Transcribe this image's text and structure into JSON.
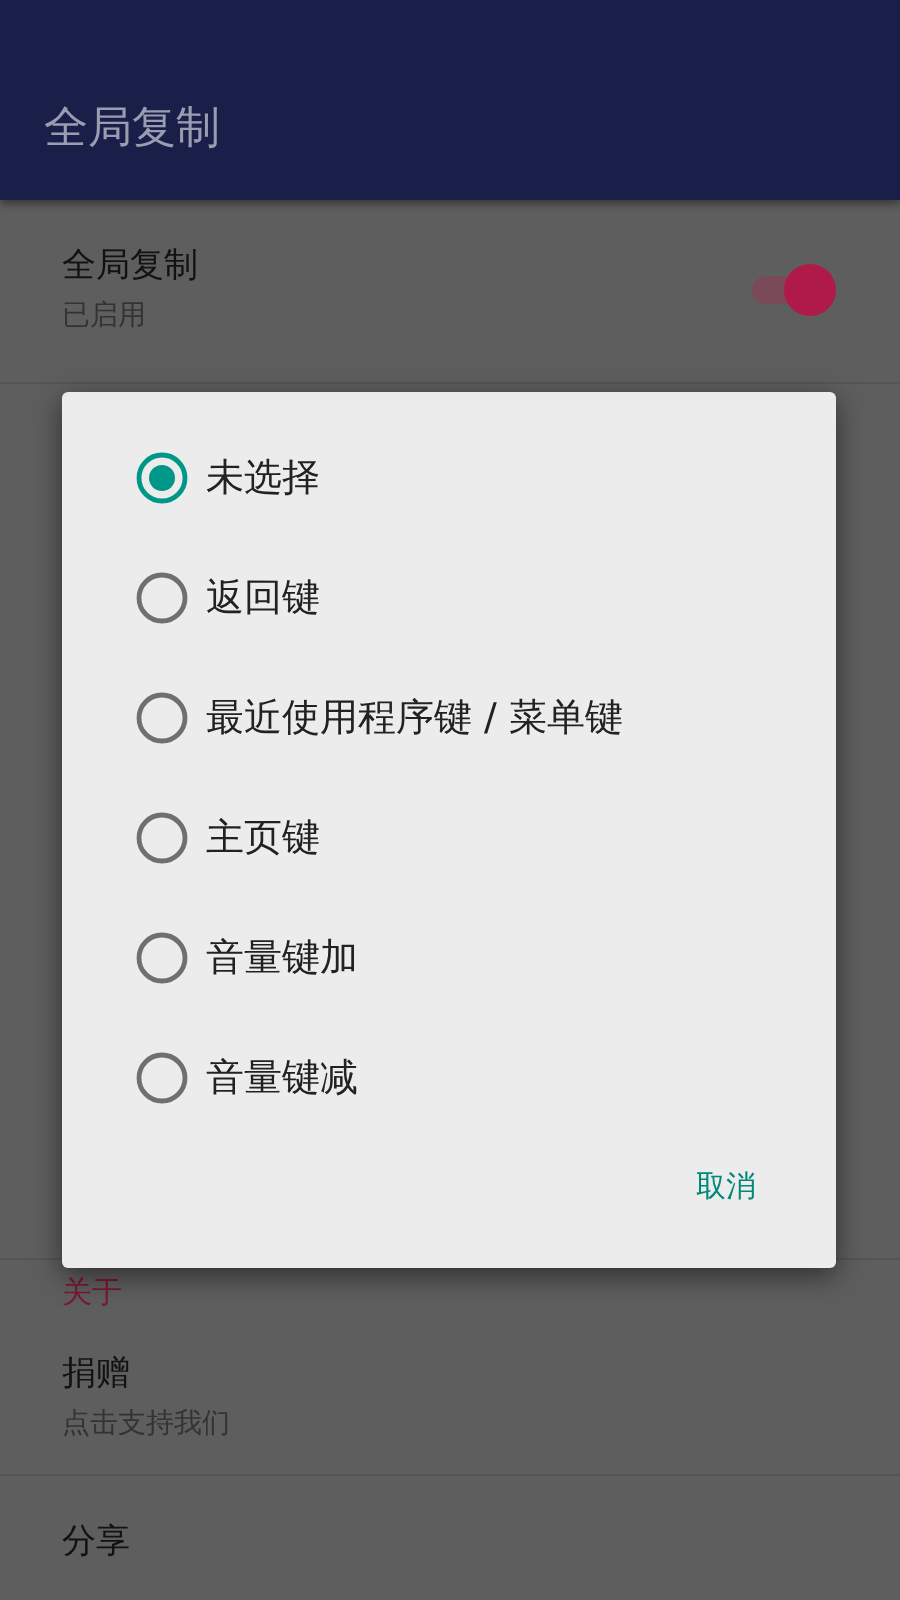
{
  "app_bar": {
    "title": "全局复制"
  },
  "settings": [
    {
      "kind": "switch",
      "title": "全局复制",
      "summary": "已启用",
      "on": true
    }
  ],
  "sections": [
    {
      "header": "关于",
      "items": [
        {
          "title": "捐赠",
          "summary": "点击支持我们"
        },
        {
          "title": "分享"
        }
      ]
    }
  ],
  "dialog": {
    "options": [
      {
        "label": "未选择",
        "selected": true
      },
      {
        "label": "返回键",
        "selected": false
      },
      {
        "label": "最近使用程序键 / 菜单键",
        "selected": false
      },
      {
        "label": "主页键",
        "selected": false
      },
      {
        "label": "音量键加",
        "selected": false
      },
      {
        "label": "音量键减",
        "selected": false
      }
    ],
    "buttons": [
      "取消"
    ]
  }
}
